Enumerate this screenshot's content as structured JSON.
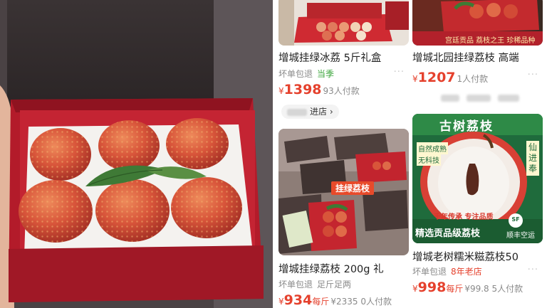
{
  "colors": {
    "price_red": "#e5412d",
    "tag_green": "#3aa43a",
    "box_red": "#b31b2a",
    "lychee": "#d9563d"
  },
  "products": [
    {
      "title": "增城挂绿冰荔 5斤礼盒",
      "shipping": "坏单包退",
      "tag": "当季",
      "currency": "¥",
      "price": "1398",
      "unit": "",
      "sold": "93人付款",
      "store_label": "进店 ›",
      "more": "···"
    },
    {
      "title": "增城北园挂绿荔枝 高端",
      "currency": "¥",
      "price": "1207",
      "unit": "",
      "sold": "1人付款",
      "more": "···",
      "thumb_banner": "宫廷贡品  荔枝之王  珍稀品种"
    },
    {
      "title": "增城挂绿荔枝 200g 礼",
      "shipping": "坏单包退",
      "tag": "足斤足两",
      "currency": "¥",
      "price": "934",
      "unit": "每斤",
      "sold": "¥2335 0人付款",
      "more": "···",
      "thumb_badge": "挂绿荔枝"
    },
    {
      "title": "增城老树糯米糍荔枝50",
      "shipping": "坏单包退",
      "tag": "8年老店",
      "currency": "¥",
      "price": "998",
      "unit": "每斤",
      "sold": "¥99.8 5人付款",
      "more": "···",
      "thumb_header": "古树荔枝",
      "thumb_side1": "自然成熟",
      "thumb_side2": "无科技",
      "thumb_vertical": "仙进奉",
      "thumb_slogan": "千年传承  专注品质",
      "thumb_footer": "精选贡品级荔枝",
      "thumb_shipping": "顺丰空运",
      "thumb_sf": "SF"
    }
  ]
}
